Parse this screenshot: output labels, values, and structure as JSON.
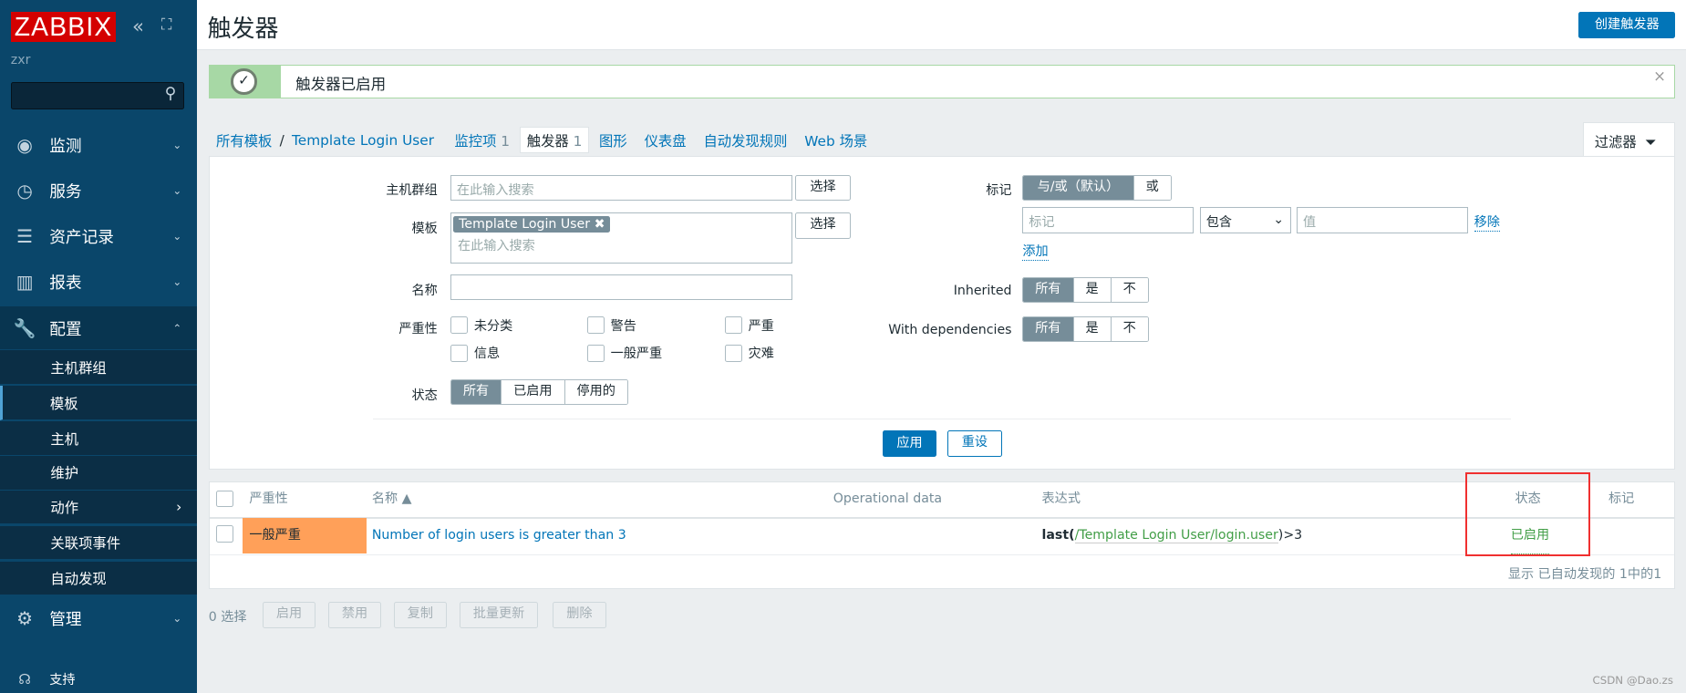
{
  "sidebar": {
    "logo": "ZABBIX",
    "user": "zxr",
    "items": [
      {
        "label": "监测",
        "icon": "eye-icon"
      },
      {
        "label": "服务",
        "icon": "clock-icon"
      },
      {
        "label": "资产记录",
        "icon": "list-icon"
      },
      {
        "label": "报表",
        "icon": "bar-chart-icon"
      },
      {
        "label": "配置",
        "icon": "wrench-icon"
      }
    ],
    "submenu": [
      "主机群组",
      "模板",
      "主机",
      "维护",
      "动作",
      "关联项事件",
      "自动发现"
    ],
    "admin": "管理",
    "support": "支持"
  },
  "header": {
    "title": "触发器",
    "create_button": "创建触发器"
  },
  "message": {
    "text": "触发器已启用",
    "close": "×"
  },
  "breadcrumb": {
    "all": "所有模板",
    "sep": "/",
    "template": "Template Login User",
    "items_tab": "监控项",
    "items_count": "1",
    "triggers_tab": "触发器",
    "triggers_count": "1",
    "graphs": "图形",
    "dashboards": "仪表盘",
    "discovery": "自动发现规则",
    "web": "Web 场景"
  },
  "filter": {
    "tab": "过滤器",
    "host_group_label": "主机群组",
    "search_placeholder": "在此输入搜索",
    "select": "选择",
    "template_label": "模板",
    "template_chip": "Template Login User",
    "name_label": "名称",
    "name_value": "",
    "severity_label": "严重性",
    "severities": [
      "未分类",
      "警告",
      "严重",
      "信息",
      "一般严重",
      "灾难"
    ],
    "state_label": "状态",
    "state_options": [
      "所有",
      "已启用",
      "停用的"
    ],
    "tags_label": "标记",
    "tags_options": [
      "与/或（默认）",
      "或"
    ],
    "tag_placeholder": "标记",
    "tag_op": "包含",
    "value_placeholder": "值",
    "remove": "移除",
    "add": "添加",
    "inherited_label": "Inherited",
    "with_deps_label": "With dependencies",
    "tri_options": [
      "所有",
      "是",
      "不"
    ],
    "apply": "应用",
    "reset": "重设"
  },
  "table": {
    "headers": [
      "严重性",
      "名称 ▲",
      "Operational data",
      "表达式",
      "状态",
      "标记"
    ],
    "rows": [
      {
        "severity": "一般严重",
        "severity_color": "#ffa059",
        "name": "Number of login users is greater than 3",
        "expr_fn": "last(",
        "expr_item": "/Template Login User/login.user",
        "expr_tail": ")>3",
        "status": "已启用",
        "status_color": "#429e47"
      }
    ],
    "footer": "显示 已自动发现的 1中的1"
  },
  "actions": {
    "selected": "0 选择",
    "buttons": [
      "启用",
      "禁用",
      "复制",
      "批量更新",
      "删除"
    ]
  },
  "watermark": "CSDN @Dao.zs"
}
